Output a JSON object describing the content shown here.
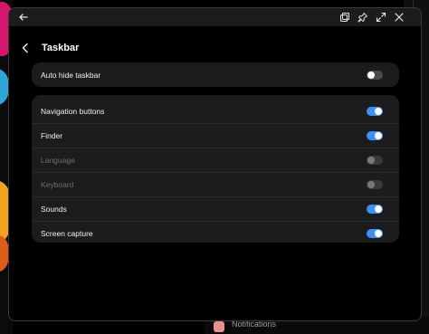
{
  "window": {
    "title_buttons": {
      "back_icon": "arrow-left-icon",
      "multiwindow_icon": "multiwindow-icon",
      "pin_icon": "pin-icon",
      "maximize_icon": "maximize-icon",
      "close_icon": "close-icon"
    }
  },
  "page": {
    "title": "Taskbar",
    "back_icon": "chevron-left-icon"
  },
  "section_one": {
    "items": [
      {
        "label": "Auto hide taskbar",
        "state": "off",
        "enabled": true
      }
    ]
  },
  "section_two": {
    "items": [
      {
        "label": "Navigation buttons",
        "state": "on",
        "enabled": true
      },
      {
        "label": "Finder",
        "state": "on",
        "enabled": true
      },
      {
        "label": "Language",
        "state": "off",
        "enabled": false
      },
      {
        "label": "Keyboard",
        "state": "off",
        "enabled": false
      },
      {
        "label": "Sounds",
        "state": "on",
        "enabled": true
      },
      {
        "label": "Screen capture",
        "state": "on",
        "enabled": true
      }
    ]
  },
  "background": {
    "bottom_app_label": "Notifications"
  },
  "colors": {
    "accent": "#3e91f4",
    "card": "#1c1c1e",
    "window_bg": "#000000",
    "disabled_text": "#6e6e70"
  }
}
